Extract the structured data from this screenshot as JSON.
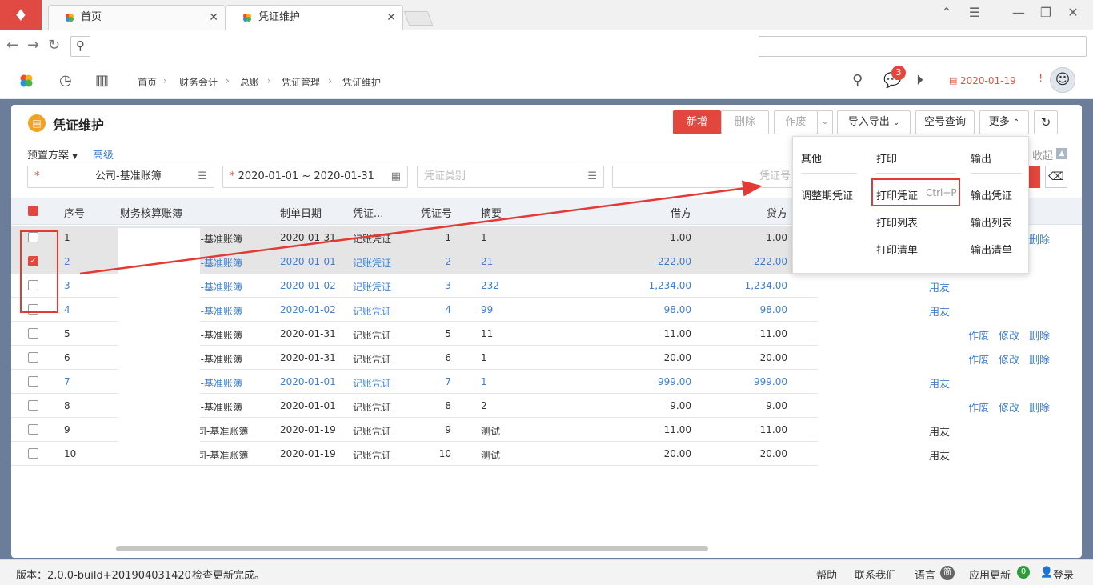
{
  "browser": {
    "tabs": [
      {
        "label": "首页"
      },
      {
        "label": "凭证维护"
      }
    ],
    "close_glyph": "✕"
  },
  "app_header": {
    "breadcrumb": [
      "首页",
      "财务会计",
      "总账",
      "凭证管理",
      "凭证维护"
    ],
    "notification_count": "3",
    "date": "2020-01-19",
    "alert": "!"
  },
  "page": {
    "title": "凭证维护",
    "toolbar": {
      "new": "新增",
      "delete": "删除",
      "void": "作废",
      "import_export": "导入导出",
      "empty_number_query": "空号查询",
      "more": "更多"
    },
    "scheme_label": "预置方案",
    "advanced_label": "高级",
    "collapse_label": "收起",
    "filters": {
      "account_book_value": "公司-基准账簿",
      "date_range_value": "2020-01-01 ~ 2020-01-31",
      "voucher_type_placeholder": "凭证类别",
      "voucher_no_placeholder": "凭证号"
    }
  },
  "table": {
    "columns": [
      "序号",
      "财务核算账簿",
      "制单日期",
      "凭证...",
      "凭证号",
      "摘要",
      "借方",
      "贷方"
    ],
    "rows": [
      {
        "no": "1",
        "book": "]-基准账簿",
        "date": "2020-01-31",
        "type": "记账凭证",
        "vno": "1",
        "summary": "1",
        "debit": "1.00",
        "credit": "1.00",
        "checked": false,
        "blue": false,
        "actions": "void-edit-delete"
      },
      {
        "no": "2",
        "book": "]-基准账簿",
        "date": "2020-01-01",
        "type": "记账凭证",
        "vno": "2",
        "summary": "21",
        "debit": "222.00",
        "credit": "222.00",
        "checked": true,
        "blue": true,
        "actions": "none"
      },
      {
        "no": "3",
        "book": "]-基准账簿",
        "date": "2020-01-02",
        "type": "记账凭证",
        "vno": "3",
        "summary": "232",
        "debit": "1,234.00",
        "credit": "1,234.00",
        "checked": false,
        "blue": true,
        "actions": "yonyou"
      },
      {
        "no": "4",
        "book": "]-基准账簿",
        "date": "2020-01-02",
        "type": "记账凭证",
        "vno": "4",
        "summary": "99",
        "debit": "98.00",
        "credit": "98.00",
        "checked": false,
        "blue": true,
        "actions": "yonyou"
      },
      {
        "no": "5",
        "book": "]-基准账簿",
        "date": "2020-01-31",
        "type": "记账凭证",
        "vno": "5",
        "summary": "11",
        "debit": "11.00",
        "credit": "11.00",
        "checked": false,
        "blue": false,
        "actions": "void-edit-delete"
      },
      {
        "no": "6",
        "book": "]-基准账簿",
        "date": "2020-01-31",
        "type": "记账凭证",
        "vno": "6",
        "summary": "1",
        "debit": "20.00",
        "credit": "20.00",
        "checked": false,
        "blue": false,
        "actions": "void-edit-delete"
      },
      {
        "no": "7",
        "book": "]-基准账簿",
        "date": "2020-01-01",
        "type": "记账凭证",
        "vno": "7",
        "summary": "1",
        "debit": "999.00",
        "credit": "999.00",
        "checked": false,
        "blue": true,
        "actions": "yonyou"
      },
      {
        "no": "8",
        "book": "]-基准账簿",
        "date": "2020-01-01",
        "type": "记账凭证",
        "vno": "8",
        "summary": "2",
        "debit": "9.00",
        "credit": "9.00",
        "checked": false,
        "blue": false,
        "actions": "void-edit-delete"
      },
      {
        "no": "9",
        "book": "司-基准账簿",
        "date": "2020-01-19",
        "type": "记账凭证",
        "vno": "9",
        "summary": "测试",
        "debit": "11.00",
        "credit": "11.00",
        "checked": false,
        "blue": false,
        "actions": "yonyou-black"
      },
      {
        "no": "10",
        "book": "司-基准账簿",
        "date": "2020-01-19",
        "type": "记账凭证",
        "vno": "10",
        "summary": "测试",
        "debit": "20.00",
        "credit": "20.00",
        "checked": false,
        "blue": false,
        "actions": "yonyou-black"
      }
    ],
    "action_labels": {
      "void": "作废",
      "edit": "修改",
      "delete": "删除",
      "yonyou": "用友"
    }
  },
  "dropdown": {
    "headers": [
      "其他",
      "打印",
      "输出"
    ],
    "other": [
      "调整期凭证"
    ],
    "print": [
      "打印凭证",
      "打印列表",
      "打印清单"
    ],
    "print_shortcut": "Ctrl+P",
    "output": [
      "输出凭证",
      "输出列表",
      "输出清单"
    ]
  },
  "status_bar": {
    "version": "版本：2.0.0-build+201904031420",
    "update_msg": "检查更新完成。",
    "help": "帮助",
    "contact": "联系我们",
    "language": "语言",
    "language_badge": "简",
    "app_update": "应用更新",
    "update_count": "0",
    "login": "登录"
  },
  "colors": {
    "accent": "#e2463c",
    "link": "#3f7fce",
    "annotation": "#e53935"
  }
}
